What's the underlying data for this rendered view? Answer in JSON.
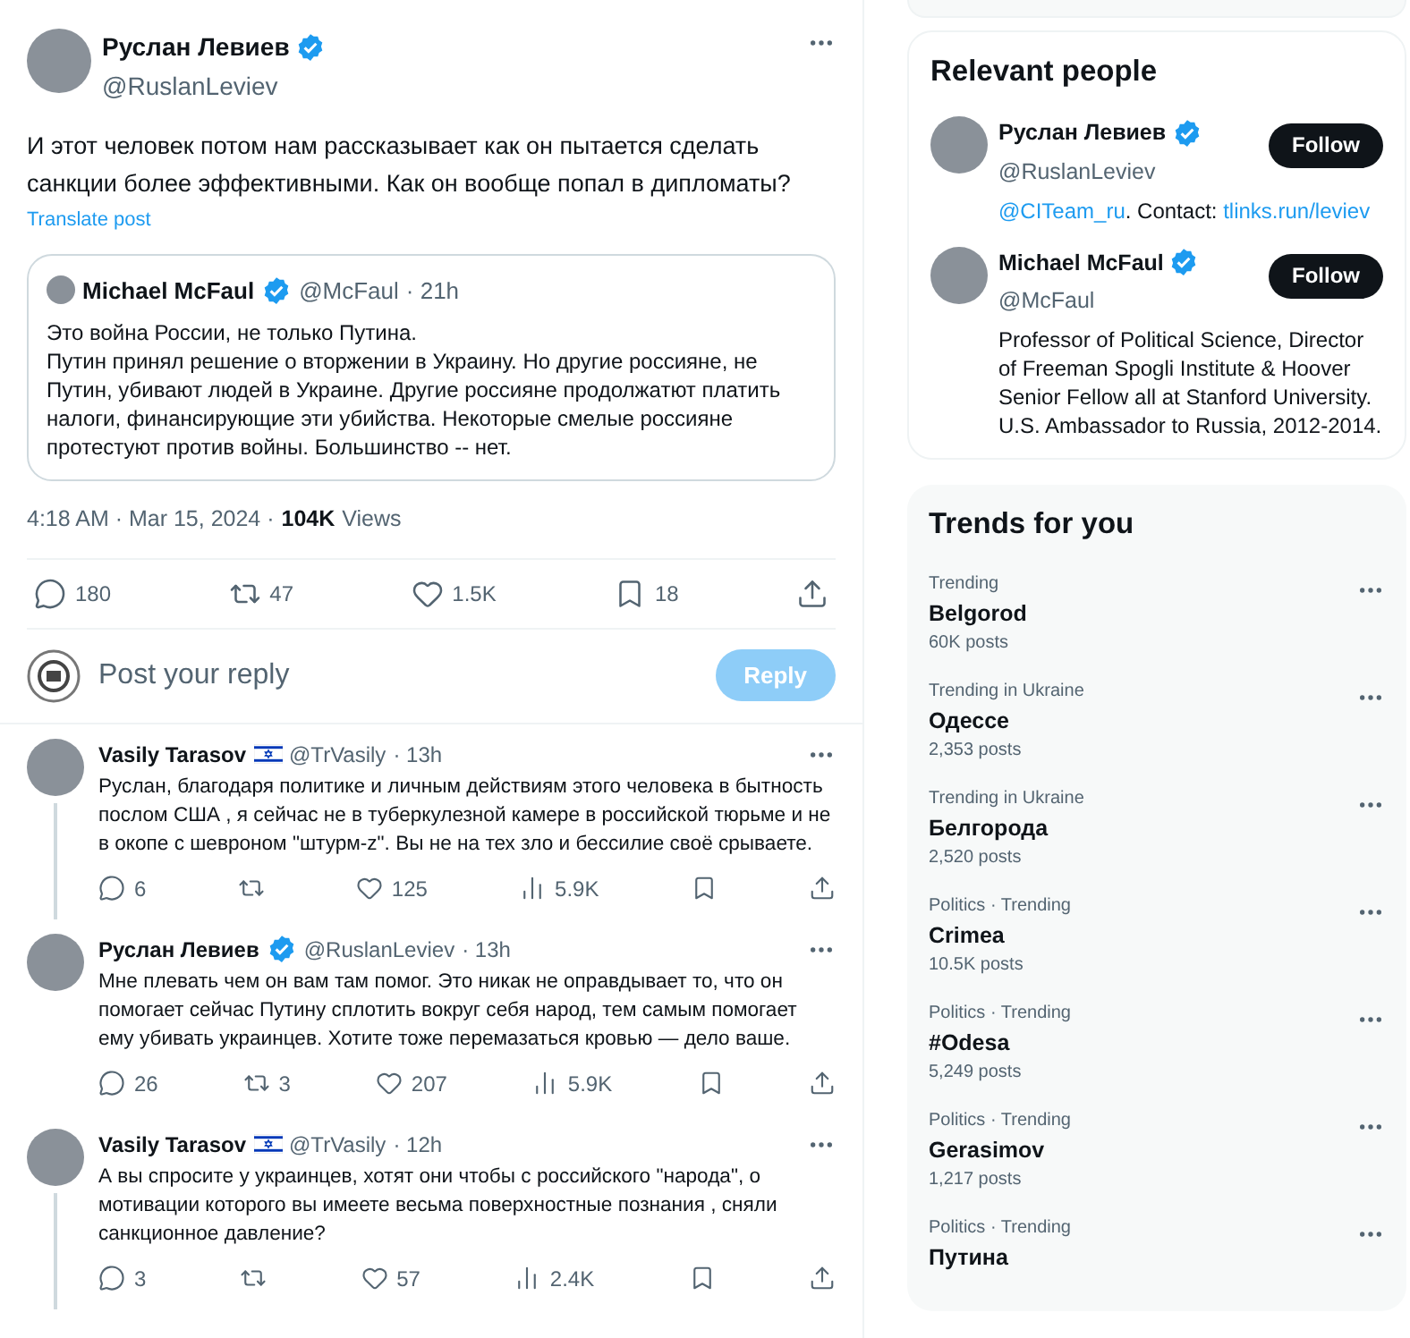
{
  "post": {
    "author": {
      "name": "Руслан Левиев",
      "handle": "@RuslanLeviev",
      "verified": true
    },
    "text": "И этот человек потом нам рассказывает как он пытается сделать санкции более эффективными. Как он вообще попал в дипломаты?",
    "translate_label": "Translate post",
    "quote": {
      "name": "Michael McFaul",
      "verified": true,
      "handle": "@McFaul",
      "time": "· 21h",
      "paragraphs": [
        "Это война России, не только Путина.",
        "Путин принял решение о вторжении в Украину. Но другие россияне, не Путин, убивают людей в Украине. Другие россияне продолжатют платить налоги, финансирующие эти убийства. Некоторые смелые россияне протестуют против войны. Большинство -- нет."
      ]
    },
    "timestamp": "4:18 AM · Mar 15, 2024 ·",
    "views_count": "104K",
    "views_label": "Views",
    "actions": [
      {
        "kind": "reply",
        "count": "180"
      },
      {
        "kind": "repost",
        "count": "47"
      },
      {
        "kind": "like",
        "count": "1.5K"
      },
      {
        "kind": "bookmark",
        "count": "18"
      },
      {
        "kind": "share"
      }
    ]
  },
  "composer": {
    "placeholder": "Post your reply",
    "button": "Reply",
    "disabled": true
  },
  "replies": [
    {
      "name": "Vasily Tarasov",
      "verified": false,
      "flag": true,
      "handle": "@TrVasily",
      "time": "· 13h",
      "thread_below": true,
      "text": "Руслан, благодаря политике и личным действиям этого человека в бытность послом США , я сейчас не в туберкулезной камере в российской тюрьме и не в окопе с шевроном \"штурм-z\". Вы не на тех зло и бессилие своё срываете.",
      "actions": [
        {
          "kind": "reply",
          "count": "6"
        },
        {
          "kind": "repost"
        },
        {
          "kind": "like",
          "count": "125"
        },
        {
          "kind": "views",
          "count": "5.9K"
        },
        {
          "kind": "bookmark"
        },
        {
          "kind": "share"
        }
      ]
    },
    {
      "name": "Руслан Левиев",
      "verified": true,
      "flag": false,
      "handle": "@RuslanLeviev",
      "time": "· 13h",
      "thread_below": false,
      "text": "Мне плевать чем он вам там помог. Это никак не оправдывает то, что он помогает сейчас Путину сплотить вокруг себя народ, тем самым помогает ему убивать украинцев. Хотите тоже перемазаться кровью — дело ваше.",
      "actions": [
        {
          "kind": "reply",
          "count": "26"
        },
        {
          "kind": "repost",
          "count": "3"
        },
        {
          "kind": "like",
          "count": "207"
        },
        {
          "kind": "views",
          "count": "5.9K"
        },
        {
          "kind": "bookmark"
        },
        {
          "kind": "share"
        }
      ]
    },
    {
      "name": "Vasily Tarasov",
      "verified": false,
      "flag": true,
      "handle": "@TrVasily",
      "time": "· 12h",
      "thread_below": true,
      "text": "А вы спросите у украинцев, хотят они чтобы с российского \"народа\", о мотивации которого вы имеете весьма поверхностные познания , сняли санкционное давление?",
      "actions": [
        {
          "kind": "reply",
          "count": "3"
        },
        {
          "kind": "repost"
        },
        {
          "kind": "like",
          "count": "57"
        },
        {
          "kind": "views",
          "count": "2.4K"
        },
        {
          "kind": "bookmark"
        },
        {
          "kind": "share"
        }
      ]
    }
  ],
  "relevant_people": {
    "title": "Relevant people",
    "people": [
      {
        "name": "Руслан Левиев",
        "verified": true,
        "handle": "@RuslanLeviev",
        "follow": "Follow",
        "bio": [
          {
            "text": "@CITeam_ru",
            "link": true
          },
          {
            "text": ". Contact: ",
            "link": false
          },
          {
            "text": "tlinks.run/leviev",
            "link": true
          }
        ]
      },
      {
        "name": "Michael McFaul",
        "verified": true,
        "handle": "@McFaul",
        "follow": "Follow",
        "bio": [
          {
            "text": "Professor of Political Science, Director of Freeman Spogli Institute & Hoover Senior Fellow all at Stanford University. U.S. Ambassador to Russia, 2012-2014.",
            "link": false
          }
        ]
      }
    ]
  },
  "trends": {
    "title": "Trends for you",
    "items": [
      {
        "context": "Trending",
        "topic": "Belgorod",
        "count": "60K posts"
      },
      {
        "context": "Trending in Ukraine",
        "topic": "Одессе",
        "count": "2,353 posts"
      },
      {
        "context": "Trending in Ukraine",
        "topic": "Белгорода",
        "count": "2,520 posts"
      },
      {
        "context": "Politics · Trending",
        "topic": "Crimea",
        "count": "10.5K posts"
      },
      {
        "context": "Politics · Trending",
        "topic": "#Odesa",
        "count": "5,249 posts"
      },
      {
        "context": "Politics · Trending",
        "topic": "Gerasimov",
        "count": "1,217 posts"
      },
      {
        "context": "Politics · Trending",
        "topic": "Путина"
      }
    ]
  }
}
